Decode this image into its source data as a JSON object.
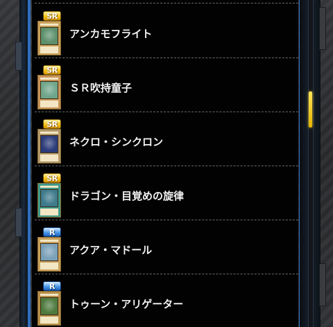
{
  "card_list": {
    "items": [
      {
        "rarity": "SR",
        "name": "アンカモフライト",
        "art": "#5c8f6b",
        "frame": "#c9a05a"
      },
      {
        "rarity": "SR",
        "name": "ＳＲ吹持童子",
        "art": "#6fa58a",
        "frame": "#c9945a"
      },
      {
        "rarity": "SR",
        "name": "ネクロ・シンクロン",
        "art": "#2c3c7a",
        "frame": "#b49a6a"
      },
      {
        "rarity": "SR",
        "name": "ドラゴン・目覚めの旋律",
        "art": "#3e7a8c",
        "frame": "#3f9a8a"
      },
      {
        "rarity": "R",
        "name": "アクア・マドール",
        "art": "#7aa0b8",
        "frame": "#c9a05a"
      },
      {
        "rarity": "R",
        "name": "トゥーン・アリゲーター",
        "art": "#4e7a3e",
        "frame": "#b88f4a"
      }
    ]
  },
  "colors": {
    "panel_bg": "#020202",
    "frame_blue": "#2f6fc0",
    "scroll_thumb": "#f4c21e",
    "sr_badge": "#f4c21e",
    "r_badge": "#4a9ae8"
  }
}
